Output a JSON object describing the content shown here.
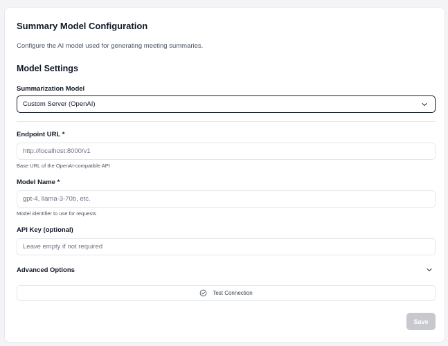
{
  "header": {
    "title": "Summary Model Configuration",
    "description": "Configure the AI model used for generating meeting summaries."
  },
  "model_settings": {
    "section_title": "Model Settings",
    "summarization_label": "Summarization Model",
    "summarization_value": "Custom Server (OpenAI)",
    "select_icon": "chevron-down-icon"
  },
  "endpoint": {
    "label": "Endpoint URL *",
    "placeholder": "http://localhost:8000/v1",
    "value": "",
    "hint": "Base URL of the OpenAI-compatible API"
  },
  "model_name": {
    "label": "Model Name *",
    "placeholder": "gpt-4, llama-3-70b, etc.",
    "value": "",
    "hint": "Model identifier to use for requests"
  },
  "api_key": {
    "label": "API Key (optional)",
    "placeholder": "Leave empty if not required",
    "value": ""
  },
  "advanced": {
    "label": "Advanced Options",
    "icon": "chevron-down-icon"
  },
  "actions": {
    "test_label": "Test Connection",
    "test_icon": "check-circle-icon",
    "save_label": "Save"
  },
  "colors": {
    "save_disabled_bg": "#c7c9cf",
    "border": "#e5e7eb",
    "text": "#111827",
    "muted": "#4b5563"
  }
}
